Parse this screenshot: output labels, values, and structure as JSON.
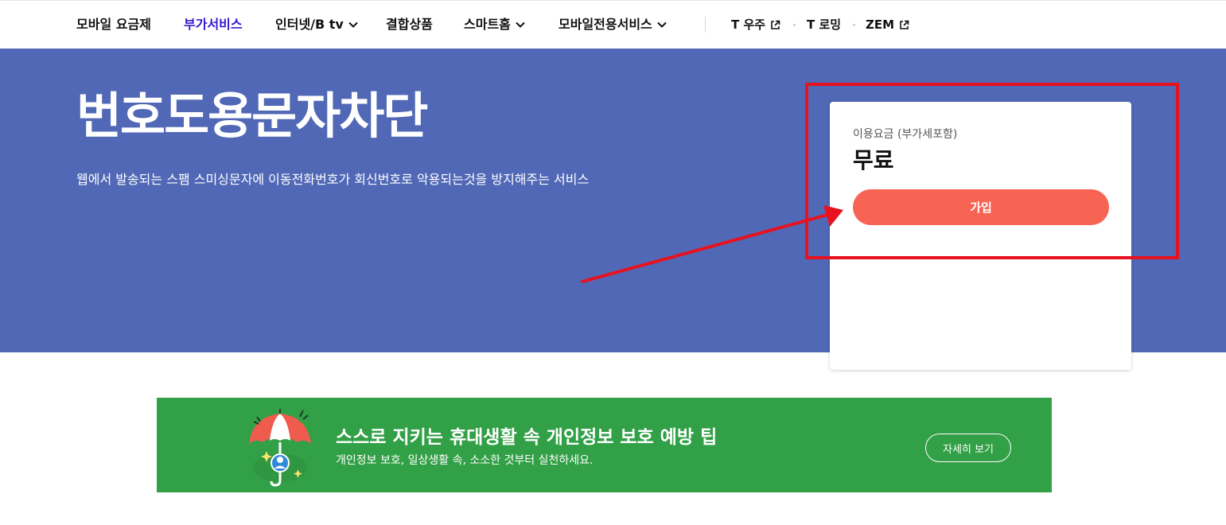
{
  "nav": {
    "items": [
      {
        "label": "모바일 요금제"
      },
      {
        "label": "부가서비스",
        "active": true
      },
      {
        "label": "인터넷/B tv",
        "has_dropdown": true
      },
      {
        "label": "결합상품"
      },
      {
        "label": "스마트홈",
        "has_dropdown": true
      },
      {
        "label": "모바일전용서비스",
        "has_dropdown": true
      }
    ],
    "external": [
      {
        "label": "T 우주",
        "icon": "external-link-icon"
      },
      {
        "label": "T 로밍"
      },
      {
        "label": "ZEM",
        "icon": "external-link-icon"
      }
    ],
    "active_color": "#3617ce"
  },
  "hero": {
    "title": "번호도용문자차단",
    "description": "웹에서 발송되는 스팸 스미싱문자에 이동전화번호가 회신번호로 악용되는것을 방지해주는 서비스",
    "background": "#5068b6"
  },
  "price_card": {
    "fee_label": "이용요금 (부가세포함)",
    "fee_value": "무료",
    "join_button": "가입",
    "button_color": "#f86454"
  },
  "annotation": {
    "color": "#e8121f",
    "shapes": [
      "highlight-box",
      "arrow"
    ]
  },
  "banner": {
    "title": "스스로 지키는 휴대생활 속 개인정보 보호 예방 팁",
    "subtitle": "개인정보 보호, 일상생활 속, 소소한 것부터 실천하세요.",
    "button": "자세히 보기",
    "icon": "umbrella-icon",
    "background": "#32a047"
  }
}
